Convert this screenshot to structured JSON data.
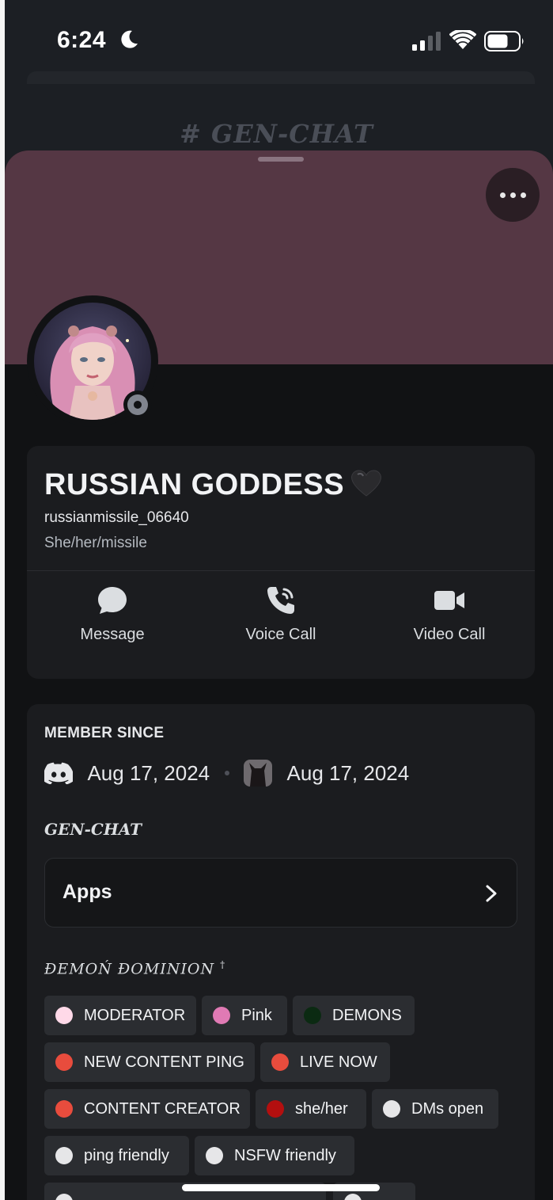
{
  "status_bar": {
    "time": "6:24"
  },
  "background": {
    "channel_title": "# GEN-CHAT"
  },
  "profile": {
    "display_name": "RUSSIAN GODDESS",
    "username": "russianmissile_06640",
    "pronouns": "She/her/missile",
    "status": "idle",
    "banner_color": "#553744"
  },
  "actions": [
    {
      "label": "Message",
      "icon": "chat-bubble-icon"
    },
    {
      "label": "Voice Call",
      "icon": "phone-icon"
    },
    {
      "label": "Video Call",
      "icon": "video-camera-icon"
    }
  ],
  "member_since": {
    "title": "MEMBER SINCE",
    "discord_date": "Aug 17, 2024",
    "server_date": "Aug 17, 2024"
  },
  "gen_chat": {
    "label": "GEN-CHAT",
    "apps_label": "Apps"
  },
  "roles_section": {
    "server_name": "ĐEMOŃ ĐOMINION",
    "mark": "†",
    "roles": [
      {
        "name": "MODERATOR",
        "color": "#ffd9e8"
      },
      {
        "name": "Pink",
        "color": "#e07ab4"
      },
      {
        "name": "DEMONS",
        "color": "#0b2a12"
      },
      {
        "name": "NEW CONTENT PING",
        "color": "#e84c3d"
      },
      {
        "name": "LIVE NOW",
        "color": "#e84c3d"
      },
      {
        "name": "CONTENT CREATOR",
        "color": "#e84c3d"
      },
      {
        "name": "she/her",
        "color": "#b30f0f"
      },
      {
        "name": "DMs open",
        "color": "#e6e6e8"
      },
      {
        "name": "ping friendly",
        "color": "#e6e6e8"
      },
      {
        "name": "NSFW friendly",
        "color": "#e6e6e8"
      }
    ]
  }
}
